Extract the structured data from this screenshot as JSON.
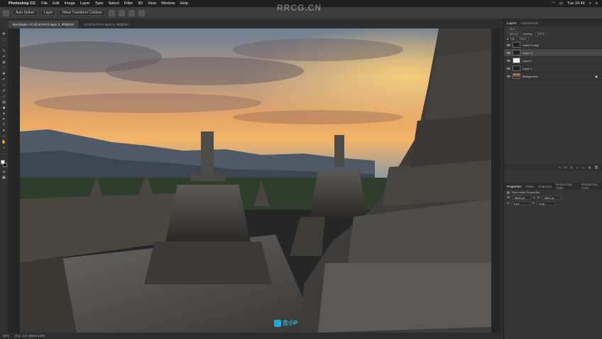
{
  "menubar": {
    "apple": "",
    "app_name": "Photoshop CC",
    "items": [
      "File",
      "Edit",
      "Image",
      "Layer",
      "Type",
      "Select",
      "Filter",
      "3D",
      "View",
      "Window",
      "Help"
    ],
    "clock": "Tue 15:49"
  },
  "options_bar": {
    "field1": "Auto Select:",
    "field2": "Layer",
    "field3": "Show Transform Controls"
  },
  "tabs": [
    {
      "label": "Borobudur-×Croft & PATS.layer 2, RGB/16*",
      "active": true
    },
    {
      "label": "×Croft & PATS.layer 2, RGB/16*",
      "active": false
    }
  ],
  "layers_panel": {
    "tabs": [
      "Layers",
      "Adjustments"
    ],
    "kind": "Kind",
    "blend": "Normal",
    "opacity_label": "Opacity:",
    "opacity_value": "100%",
    "fill_label": "Fill:",
    "fill_value": "100%",
    "layers": [
      {
        "name": "Layer 3 copy",
        "thumb": "dark",
        "selected": false
      },
      {
        "name": "Layer 3",
        "thumb": "dark",
        "selected": true
      },
      {
        "name": "Layer 2",
        "thumb": "white",
        "selected": false
      },
      {
        "name": "Layer 1",
        "thumb": "dark",
        "selected": false
      },
      {
        "name": "Background",
        "thumb": "photo",
        "selected": false
      }
    ]
  },
  "props_panel": {
    "tabs": [
      "Properties",
      "Paths",
      "Channels",
      "Retouching Tools",
      "Retouching Tools"
    ],
    "title": "Pixel Layer Properties",
    "w_label": "W:",
    "w_value": "6000 px",
    "h_label": "H:",
    "h_value": "4000 px",
    "x_label": "X:",
    "x_value": "0 px",
    "y_label": "Y:",
    "y_value": "0 px"
  },
  "status": {
    "zoom": "25%",
    "doc": "Doc: 137.3M/274.6M"
  },
  "watermark": "RRCG.CN",
  "logo_text": "吉小P"
}
